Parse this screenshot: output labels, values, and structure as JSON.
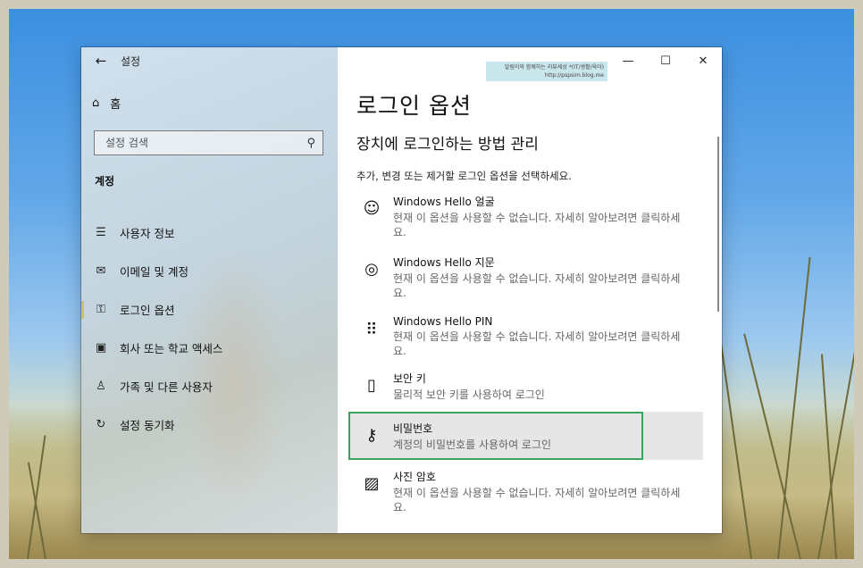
{
  "window": {
    "title": "설정",
    "back_icon": "←",
    "minimize_icon": "—",
    "maximize_icon": "☐",
    "close_icon": "✕"
  },
  "sidebar": {
    "home_icon": "⌂",
    "home_label": "홈",
    "search_placeholder": "설정 검색",
    "search_icon": "⚲",
    "section_label": "계정",
    "items": [
      {
        "icon": "☰",
        "label": "사용자 정보"
      },
      {
        "icon": "✉",
        "label": "이메일 및 계정"
      },
      {
        "icon": "⚿",
        "label": "로그인 옵션"
      },
      {
        "icon": "▣",
        "label": "회사 또는 학교 액세스"
      },
      {
        "icon": "♙",
        "label": "가족 및 다른 사용자"
      },
      {
        "icon": "↻",
        "label": "설정 동기화"
      }
    ],
    "active_index": 2
  },
  "watermark": {
    "line1": "알림이와 함께하는 리뷰세상 *(IT/생활/육아)",
    "line2": "http://pspsim.blog.me"
  },
  "main": {
    "title": "로그인 옵션",
    "subtitle": "장치에 로그인하는 방법 관리",
    "description": "추가, 변경 또는 제거할 로그인 옵션을 선택하세요.",
    "options": [
      {
        "icon": "☺",
        "name": "Windows Hello 얼굴",
        "desc": "현재 이 옵션을 사용할 수 없습니다. 자세히 알아보려면 클릭하세요."
      },
      {
        "icon": "◎",
        "name": "Windows Hello 지문",
        "desc": "현재 이 옵션을 사용할 수 없습니다. 자세히 알아보려면 클릭하세요."
      },
      {
        "icon": "⠿",
        "name": "Windows Hello PIN",
        "desc": "현재 이 옵션을 사용할 수 없습니다. 자세히 알아보려면 클릭하세요."
      },
      {
        "icon": "▯",
        "name": "보안 키",
        "desc": "물리적 보안 키를 사용하여 로그인"
      },
      {
        "icon": "⚷",
        "name": "비밀번호",
        "desc": "계정의 비밀번호를 사용하여 로그인"
      },
      {
        "icon": "▨",
        "name": "사진 암호",
        "desc": "현재 이 옵션을 사용할 수 없습니다. 자세히 알아보려면 클릭하세요."
      }
    ],
    "selected_index": 4
  }
}
